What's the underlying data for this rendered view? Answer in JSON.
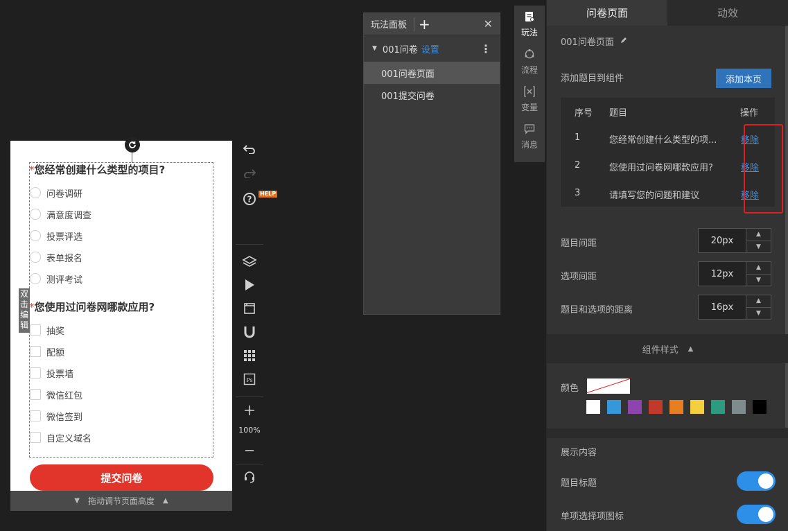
{
  "canvas": {
    "side_tag": "双击编辑",
    "questions": [
      {
        "required_mark": "*",
        "title": "您经常创建什么类型的项目?",
        "options": [
          "问卷调研",
          "满意度调查",
          "投票评选",
          "表单报名",
          "测评考试"
        ]
      },
      {
        "required_mark": "*",
        "title": "您使用过问卷网哪款应用?",
        "options": [
          "抽奖",
          "配额",
          "投票墙",
          "微信红包",
          "微信签到",
          "自定义域名"
        ]
      }
    ],
    "submit_label": "提交问卷",
    "drag_hint": "拖动调节页面高度"
  },
  "toolbar": {
    "help_badge": "HELP",
    "zoom": "100%"
  },
  "play_panel": {
    "title": "玩法面板",
    "group": {
      "name": "001问卷",
      "setting_label": "设置"
    },
    "items": [
      {
        "label": "001问卷页面",
        "active": true
      },
      {
        "label": "001提交问卷",
        "active": false
      }
    ]
  },
  "modes": [
    {
      "icon": "play-mode-icon",
      "label": "玩法",
      "active": true
    },
    {
      "icon": "flow-icon",
      "label": "流程",
      "active": false
    },
    {
      "icon": "variable-icon",
      "label": "变量",
      "active": false
    },
    {
      "icon": "message-icon",
      "label": "消息",
      "active": false
    }
  ],
  "right_panel": {
    "tabs": [
      {
        "label": "问卷页面",
        "active": true
      },
      {
        "label": "动效",
        "active": false
      }
    ],
    "page_name": "001问卷页面",
    "add_questions_label": "添加题目到组件",
    "add_page_button": "添加本页",
    "table": {
      "headers": [
        "序号",
        "题目",
        "操作"
      ],
      "rows": [
        {
          "index": "1",
          "title": "您经常创建什么类型的项...",
          "action": "移除"
        },
        {
          "index": "2",
          "title": "您使用过问卷网哪款应用?",
          "action": "移除"
        },
        {
          "index": "3",
          "title": "请填写您的问题和建议",
          "action": "移除"
        }
      ]
    },
    "spacing": [
      {
        "label": "题目间距",
        "value": "20px"
      },
      {
        "label": "选项间距",
        "value": "12px"
      },
      {
        "label": "题目和选项的距离",
        "value": "16px"
      }
    ],
    "component_style_label": "组件样式",
    "color_label": "颜色",
    "swatches": [
      "#ffffff",
      "#3498db",
      "#8e44ad",
      "#c0392b",
      "#e67e22",
      "#f4d03f",
      "#2e9b80",
      "#7f8c8d",
      "#000000"
    ],
    "display_content_label": "展示内容",
    "toggles": [
      {
        "label": "题目标题",
        "on": true
      },
      {
        "label": "单项选择项图标",
        "on": true
      }
    ]
  }
}
